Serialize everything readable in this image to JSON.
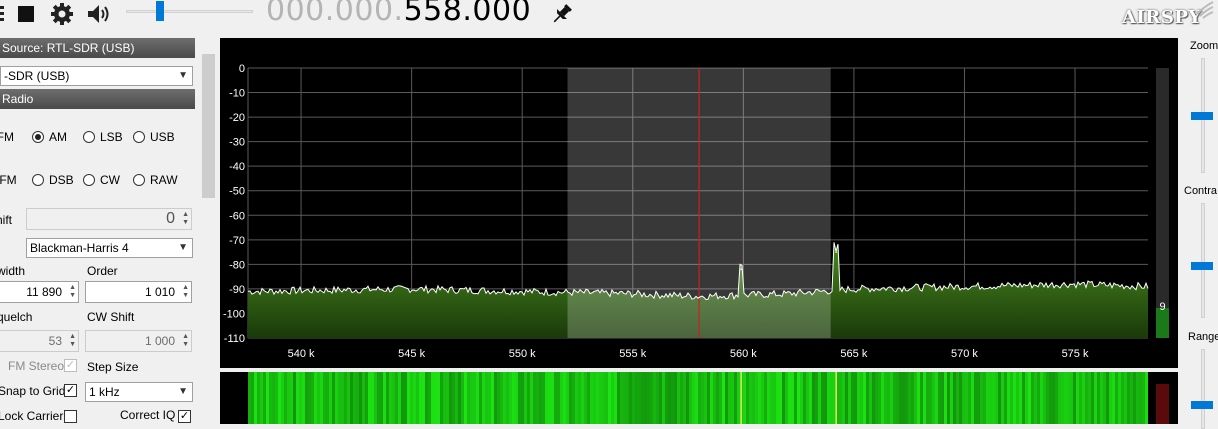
{
  "toolbar": {
    "frequency_dim": "000.000.",
    "frequency_main": "558.000",
    "volume_level": 0.27,
    "logo": "AIRSPY"
  },
  "source": {
    "header": "Source: RTL-SDR (USB)",
    "device": "-SDR (USB)"
  },
  "radio": {
    "header": "Radio",
    "modes_row1": [
      "NFM",
      "AM",
      "LSB",
      "USB"
    ],
    "modes_row2": [
      "WFM",
      "DSB",
      "CW",
      "RAW"
    ],
    "selected_mode": "AM",
    "shift_label": "hift",
    "shift_value": "0",
    "filter_label": "r",
    "filter_value": "Blackman-Harris 4",
    "bandwidth_label": "width",
    "bandwidth_value": "11 890",
    "order_label": "Order",
    "order_value": "1 010",
    "squelch_label": "quelch",
    "squelch_value": "53",
    "cw_shift_label": "CW Shift",
    "cw_shift_value": "1 000",
    "fm_stereo_label": "FM Stereo",
    "step_size_label": "Step Size",
    "step_size_value": "1 kHz",
    "snap_label": "Snap to Grid",
    "lock_carrier_label": "Lock Carrier",
    "correct_iq_label": "Correct IQ"
  },
  "right_panel": {
    "zoom_label": "Zoom",
    "contrast_label": "Contra",
    "range_label": "Range",
    "zoom_level": 0.5,
    "contrast_level": 0.45,
    "range_level": 0.3
  },
  "chart_data": {
    "type": "area",
    "title": "",
    "xlabel": "",
    "ylabel": "",
    "x_unit_ticks": [
      "540 k",
      "545 k",
      "550 k",
      "555 k",
      "560 k",
      "565 k",
      "570 k",
      "575 k"
    ],
    "x_ticks": [
      540,
      545,
      550,
      555,
      560,
      565,
      570,
      575
    ],
    "y_ticks": [
      0,
      -10,
      -20,
      -30,
      -40,
      -50,
      -60,
      -70,
      -80,
      -90,
      -100,
      -110
    ],
    "xlim": [
      537.6,
      578.3
    ],
    "ylim": [
      -110,
      0
    ],
    "center_frequency": 558,
    "filter_band": [
      552.05,
      563.95
    ],
    "peaks": [
      {
        "x": 559.9,
        "y": -82
      },
      {
        "x": 564.2,
        "y": -75
      }
    ],
    "noise_floor": [
      {
        "x": 537.6,
        "y": -91
      },
      {
        "x": 545,
        "y": -90
      },
      {
        "x": 550,
        "y": -91
      },
      {
        "x": 555,
        "y": -92
      },
      {
        "x": 558,
        "y": -93
      },
      {
        "x": 562,
        "y": -92
      },
      {
        "x": 565,
        "y": -90
      },
      {
        "x": 570,
        "y": -89
      },
      {
        "x": 575,
        "y": -88
      },
      {
        "x": 578.3,
        "y": -89
      }
    ],
    "level_meter_label": "9",
    "grid": true,
    "colors": {
      "background": "#000000",
      "grid": "#5a5a5a",
      "fill_top": "#4a8a1f",
      "fill_bottom": "#1a3a0a",
      "trace": "#ffffff",
      "center_line": "#cc2020",
      "filter_band": "#ffffff"
    }
  }
}
